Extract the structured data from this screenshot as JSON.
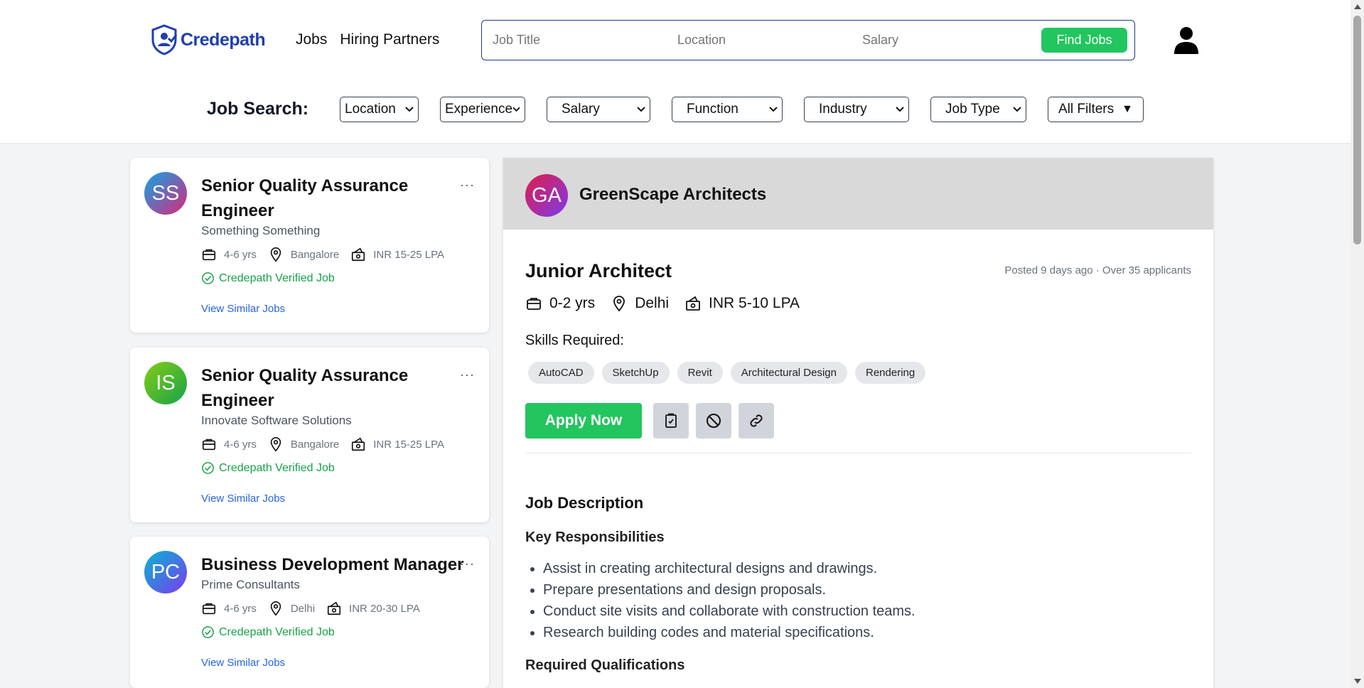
{
  "header": {
    "brand": "Credepath",
    "nav": [
      "Jobs",
      "Hiring Partners"
    ],
    "search": {
      "job_title_placeholder": "Job Title",
      "location_placeholder": "Location",
      "salary_placeholder": "Salary",
      "find_label": "Find Jobs"
    }
  },
  "filters": {
    "label": "Job Search:",
    "selects": [
      "Location",
      "Experience",
      "Salary",
      "Function",
      "Industry",
      "Job Type"
    ],
    "all_filters": "All Filters"
  },
  "jobs": [
    {
      "initials": "SS",
      "title": "Senior Quality Assurance Engineer",
      "company": "Something Something",
      "experience": "4-6 yrs",
      "location": "Bangalore",
      "salary": "INR 15-25 LPA",
      "verified": "Credepath Verified Job",
      "similar": "View Similar Jobs"
    },
    {
      "initials": "IS",
      "title": "Senior Quality Assurance Engineer",
      "company": "Innovate Software Solutions",
      "experience": "4-6 yrs",
      "location": "Bangalore",
      "salary": "INR 15-25 LPA",
      "verified": "Credepath Verified Job",
      "similar": "View Similar Jobs"
    },
    {
      "initials": "PC",
      "title": "Business Development Manager",
      "company": "Prime Consultants",
      "experience": "4-6 yrs",
      "location": "Delhi",
      "salary": "INR 20-30 LPA",
      "verified": "Credepath Verified Job",
      "similar": "View Similar Jobs"
    }
  ],
  "detail": {
    "initials": "GA",
    "company": "GreenScape Architects",
    "title": "Junior Architect",
    "posted": "Posted 9 days ago · Over 35 applicants",
    "experience": "0-2 yrs",
    "location": "Delhi",
    "salary": "INR 5-10 LPA",
    "skills_label": "Skills Required:",
    "skills": [
      "AutoCAD",
      "SketchUp",
      "Revit",
      "Architectural Design",
      "Rendering"
    ],
    "apply_label": "Apply Now",
    "description_heading": "Job Description",
    "responsibilities_heading": "Key Responsibilities",
    "responsibilities": [
      "Assist in creating architectural designs and drawings.",
      "Prepare presentations and design proposals.",
      "Conduct site visits and collaborate with construction teams.",
      "Research building codes and material specifications."
    ],
    "qualifications_heading": "Required Qualifications"
  },
  "colors": {
    "accent_green": "#22c55e",
    "brand_blue": "#1e3fae",
    "link_blue": "#2563eb"
  }
}
